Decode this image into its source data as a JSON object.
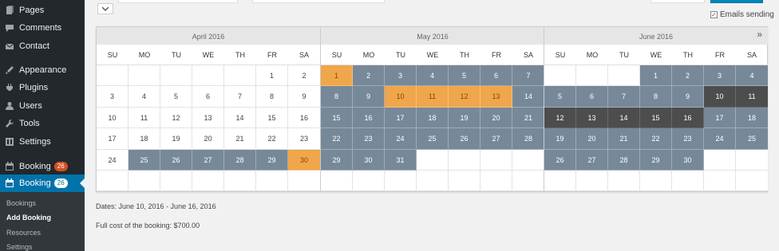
{
  "sidebar": {
    "items": [
      {
        "label": "Pages",
        "icon": "pages-icon",
        "badge": "",
        "active": false
      },
      {
        "label": "Comments",
        "icon": "comments-icon",
        "badge": "",
        "active": false
      },
      {
        "label": "Contact",
        "icon": "mail-icon",
        "badge": "",
        "active": false
      },
      {
        "label": "Appearance",
        "icon": "appearance-icon",
        "badge": "",
        "active": false
      },
      {
        "label": "Plugins",
        "icon": "plugins-icon",
        "badge": "",
        "active": false
      },
      {
        "label": "Users",
        "icon": "users-icon",
        "badge": "",
        "active": false
      },
      {
        "label": "Tools",
        "icon": "tools-icon",
        "badge": "",
        "active": false
      },
      {
        "label": "Settings",
        "icon": "settings-icon",
        "badge": "",
        "active": false
      },
      {
        "label": "Booking",
        "icon": "calendar-icon",
        "badge": "26",
        "active": false
      },
      {
        "label": "Booking",
        "icon": "calendar-icon",
        "badge": "26",
        "active": true
      }
    ],
    "submenu": [
      "Bookings",
      "Add Booking",
      "Resources",
      "Settings"
    ],
    "submenu_current": "Add Booking"
  },
  "options": {
    "emails_label": "Emails sending",
    "emails_checked": true
  },
  "calendar": {
    "dow": [
      "SU",
      "MO",
      "TU",
      "WE",
      "TH",
      "FR",
      "SA"
    ],
    "months": [
      {
        "name": "April 2016",
        "weeks": [
          [
            [
              "",
              ""
            ],
            [
              "",
              ""
            ],
            [
              "",
              ""
            ],
            [
              "",
              ""
            ],
            [
              "",
              ""
            ],
            [
              "1",
              ""
            ],
            [
              "2",
              ""
            ]
          ],
          [
            [
              "3",
              ""
            ],
            [
              "4",
              ""
            ],
            [
              "5",
              ""
            ],
            [
              "6",
              ""
            ],
            [
              "7",
              ""
            ],
            [
              "8",
              ""
            ],
            [
              "9",
              ""
            ]
          ],
          [
            [
              "10",
              ""
            ],
            [
              "11",
              ""
            ],
            [
              "12",
              ""
            ],
            [
              "13",
              ""
            ],
            [
              "14",
              ""
            ],
            [
              "15",
              ""
            ],
            [
              "16",
              ""
            ]
          ],
          [
            [
              "17",
              ""
            ],
            [
              "18",
              ""
            ],
            [
              "19",
              ""
            ],
            [
              "20",
              ""
            ],
            [
              "21",
              ""
            ],
            [
              "22",
              ""
            ],
            [
              "23",
              ""
            ]
          ],
          [
            [
              "24",
              ""
            ],
            [
              "25",
              "booked"
            ],
            [
              "26",
              "booked"
            ],
            [
              "27",
              "booked"
            ],
            [
              "28",
              "booked"
            ],
            [
              "29",
              "booked"
            ],
            [
              "30",
              "pending"
            ]
          ],
          [
            [
              "",
              ""
            ],
            [
              "",
              ""
            ],
            [
              "",
              ""
            ],
            [
              "",
              ""
            ],
            [
              "",
              ""
            ],
            [
              "",
              ""
            ],
            [
              "",
              ""
            ]
          ]
        ]
      },
      {
        "name": "May 2016",
        "weeks": [
          [
            [
              "1",
              "pending"
            ],
            [
              "2",
              "booked"
            ],
            [
              "3",
              "booked"
            ],
            [
              "4",
              "booked"
            ],
            [
              "5",
              "booked"
            ],
            [
              "6",
              "booked"
            ],
            [
              "7",
              "booked"
            ]
          ],
          [
            [
              "8",
              "booked"
            ],
            [
              "9",
              "booked"
            ],
            [
              "10",
              "pending"
            ],
            [
              "11",
              "pending"
            ],
            [
              "12",
              "pending"
            ],
            [
              "13",
              "pending"
            ],
            [
              "14",
              "booked"
            ]
          ],
          [
            [
              "15",
              "booked"
            ],
            [
              "16",
              "booked"
            ],
            [
              "17",
              "booked"
            ],
            [
              "18",
              "booked"
            ],
            [
              "19",
              "booked"
            ],
            [
              "20",
              "booked"
            ],
            [
              "21",
              "booked"
            ]
          ],
          [
            [
              "22",
              "booked"
            ],
            [
              "23",
              "booked"
            ],
            [
              "24",
              "booked"
            ],
            [
              "25",
              "booked"
            ],
            [
              "26",
              "booked"
            ],
            [
              "27",
              "booked"
            ],
            [
              "28",
              "booked"
            ]
          ],
          [
            [
              "29",
              "booked"
            ],
            [
              "30",
              "booked"
            ],
            [
              "31",
              "booked"
            ],
            [
              "",
              ""
            ],
            [
              "",
              ""
            ],
            [
              "",
              ""
            ],
            [
              "",
              ""
            ]
          ],
          [
            [
              "",
              ""
            ],
            [
              "",
              ""
            ],
            [
              "",
              ""
            ],
            [
              "",
              ""
            ],
            [
              "",
              ""
            ],
            [
              "",
              ""
            ],
            [
              "",
              ""
            ]
          ]
        ]
      },
      {
        "name": "June 2016",
        "weeks": [
          [
            [
              "",
              ""
            ],
            [
              "",
              ""
            ],
            [
              "",
              ""
            ],
            [
              "1",
              "booked"
            ],
            [
              "2",
              "booked"
            ],
            [
              "3",
              "booked"
            ],
            [
              "4",
              "booked"
            ]
          ],
          [
            [
              "5",
              "booked"
            ],
            [
              "6",
              "booked"
            ],
            [
              "7",
              "booked"
            ],
            [
              "8",
              "booked"
            ],
            [
              "9",
              "booked"
            ],
            [
              "10",
              "selected"
            ],
            [
              "11",
              "selected"
            ]
          ],
          [
            [
              "12",
              "selected"
            ],
            [
              "13",
              "selected"
            ],
            [
              "14",
              "selected"
            ],
            [
              "15",
              "selected"
            ],
            [
              "16",
              "selected"
            ],
            [
              "17",
              "booked"
            ],
            [
              "18",
              "booked"
            ]
          ],
          [
            [
              "19",
              "booked"
            ],
            [
              "20",
              "booked"
            ],
            [
              "21",
              "booked"
            ],
            [
              "22",
              "booked"
            ],
            [
              "23",
              "booked"
            ],
            [
              "24",
              "booked"
            ],
            [
              "25",
              "booked"
            ]
          ],
          [
            [
              "26",
              "booked"
            ],
            [
              "27",
              "booked"
            ],
            [
              "28",
              "booked"
            ],
            [
              "29",
              "booked"
            ],
            [
              "30",
              "booked"
            ],
            [
              "",
              ""
            ],
            [
              "",
              ""
            ]
          ],
          [
            [
              "",
              ""
            ],
            [
              "",
              ""
            ],
            [
              "",
              ""
            ],
            [
              "",
              ""
            ],
            [
              "",
              ""
            ],
            [
              "",
              ""
            ],
            [
              "",
              ""
            ]
          ]
        ]
      }
    ],
    "next_arrow": "»",
    "colors": {
      "booked": "#778899",
      "pending": "#f0a64a",
      "selected": "#4d4d4d"
    }
  },
  "summary": {
    "dates": "Dates: June 10, 2016 - June 16, 2016",
    "cost": "Full cost of the booking: $700.00"
  }
}
